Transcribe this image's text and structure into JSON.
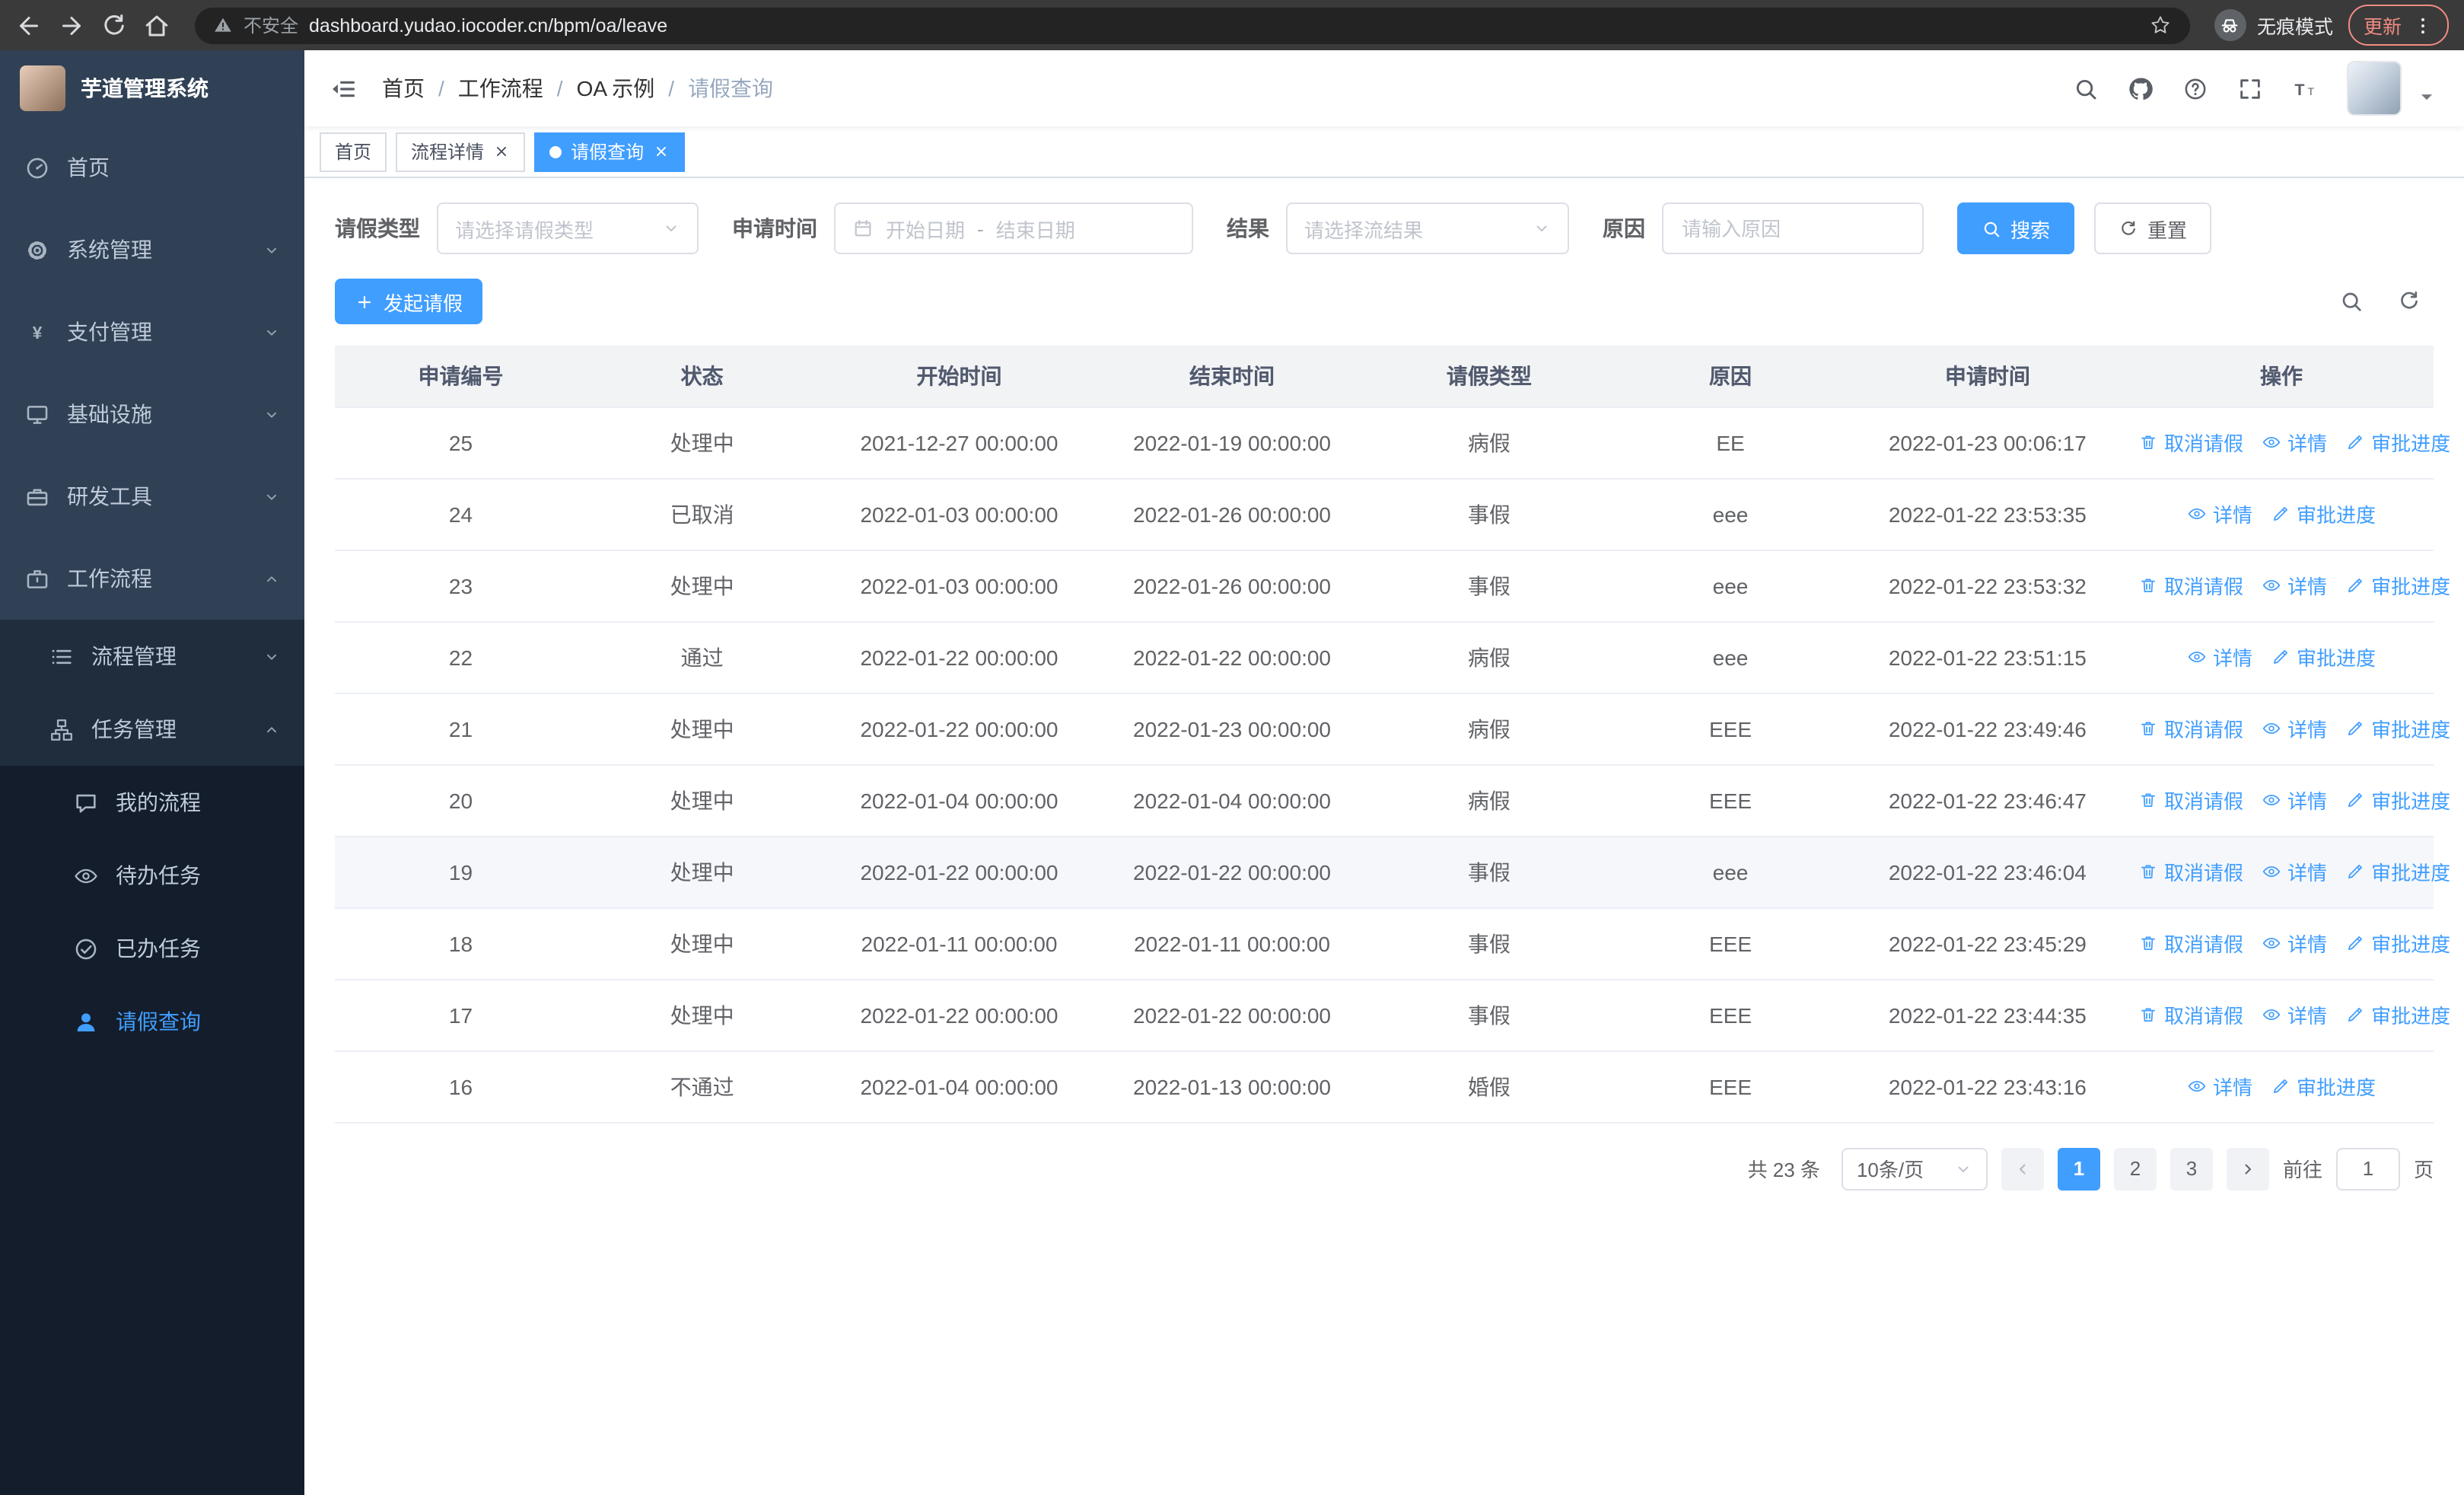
{
  "browser": {
    "security_label": "不安全",
    "url": "dashboard.yudao.iocoder.cn/bpm/oa/leave",
    "incognito_label": "无痕模式",
    "update_label": "更新"
  },
  "sidebar": {
    "logo_title": "芋道管理系统",
    "items": [
      {
        "name": "home",
        "label": "首页",
        "icon": "dashboard",
        "level": 1
      },
      {
        "name": "system-management",
        "label": "系统管理",
        "icon": "gear",
        "level": 1,
        "chevron": "down"
      },
      {
        "name": "payment-management",
        "label": "支付管理",
        "icon": "yen",
        "level": 1,
        "chevron": "down"
      },
      {
        "name": "infrastructure",
        "label": "基础设施",
        "icon": "monitor",
        "level": 1,
        "chevron": "down"
      },
      {
        "name": "dev-tools",
        "label": "研发工具",
        "icon": "toolbox",
        "level": 1,
        "chevron": "down"
      },
      {
        "name": "workflow",
        "label": "工作流程",
        "icon": "briefcase",
        "level": 1,
        "chevron": "up"
      },
      {
        "name": "process-management",
        "label": "流程管理",
        "icon": "list",
        "level": 2,
        "chevron": "down"
      },
      {
        "name": "task-management",
        "label": "任务管理",
        "icon": "flow",
        "level": 2,
        "chevron": "up"
      },
      {
        "name": "my-process",
        "label": "我的流程",
        "icon": "chat",
        "level": 3
      },
      {
        "name": "todo-tasks",
        "label": "待办任务",
        "icon": "eye",
        "level": 3
      },
      {
        "name": "done-tasks",
        "label": "已办任务",
        "icon": "check",
        "level": 3
      },
      {
        "name": "leave-query",
        "label": "请假查询",
        "icon": "user",
        "level": 3,
        "active": true
      }
    ]
  },
  "header": {
    "breadcrumb": [
      "首页",
      "工作流程",
      "OA 示例",
      "请假查询"
    ]
  },
  "tags": [
    {
      "label": "首页"
    },
    {
      "label": "流程详情",
      "closable": true
    },
    {
      "label": "请假查询",
      "closable": true,
      "active": true
    }
  ],
  "filters": {
    "leave_type_label": "请假类型",
    "leave_type_placeholder": "请选择请假类型",
    "apply_time_label": "申请时间",
    "start_date_placeholder": "开始日期",
    "range_separator": "-",
    "end_date_placeholder": "结束日期",
    "result_label": "结果",
    "result_placeholder": "请选择流结果",
    "reason_label": "原因",
    "reason_placeholder": "请输入原因",
    "search_button": "搜索",
    "reset_button": "重置"
  },
  "toolbar": {
    "create_button": "发起请假"
  },
  "table": {
    "headers": [
      "申请编号",
      "状态",
      "开始时间",
      "结束时间",
      "请假类型",
      "原因",
      "申请时间",
      "操作"
    ],
    "action_labels": {
      "cancel": "取消请假",
      "detail": "详情",
      "progress": "审批进度"
    },
    "rows": [
      {
        "id": "25",
        "status": "处理中",
        "start": "2021-12-27 00:00:00",
        "end": "2022-01-19 00:00:00",
        "type": "病假",
        "reason": "EE",
        "applied": "2022-01-23 00:06:17",
        "actions": [
          "cancel",
          "detail",
          "progress"
        ]
      },
      {
        "id": "24",
        "status": "已取消",
        "start": "2022-01-03 00:00:00",
        "end": "2022-01-26 00:00:00",
        "type": "事假",
        "reason": "eee",
        "applied": "2022-01-22 23:53:35",
        "actions": [
          "detail",
          "progress"
        ]
      },
      {
        "id": "23",
        "status": "处理中",
        "start": "2022-01-03 00:00:00",
        "end": "2022-01-26 00:00:00",
        "type": "事假",
        "reason": "eee",
        "applied": "2022-01-22 23:53:32",
        "actions": [
          "cancel",
          "detail",
          "progress"
        ]
      },
      {
        "id": "22",
        "status": "通过",
        "start": "2022-01-22 00:00:00",
        "end": "2022-01-22 00:00:00",
        "type": "病假",
        "reason": "eee",
        "applied": "2022-01-22 23:51:15",
        "actions": [
          "detail",
          "progress"
        ]
      },
      {
        "id": "21",
        "status": "处理中",
        "start": "2022-01-22 00:00:00",
        "end": "2022-01-23 00:00:00",
        "type": "病假",
        "reason": "EEE",
        "applied": "2022-01-22 23:49:46",
        "actions": [
          "cancel",
          "detail",
          "progress"
        ]
      },
      {
        "id": "20",
        "status": "处理中",
        "start": "2022-01-04 00:00:00",
        "end": "2022-01-04 00:00:00",
        "type": "病假",
        "reason": "EEE",
        "applied": "2022-01-22 23:46:47",
        "actions": [
          "cancel",
          "detail",
          "progress"
        ]
      },
      {
        "id": "19",
        "status": "处理中",
        "start": "2022-01-22 00:00:00",
        "end": "2022-01-22 00:00:00",
        "type": "事假",
        "reason": "eee",
        "applied": "2022-01-22 23:46:04",
        "actions": [
          "cancel",
          "detail",
          "progress"
        ],
        "hover": true
      },
      {
        "id": "18",
        "status": "处理中",
        "start": "2022-01-11 00:00:00",
        "end": "2022-01-11 00:00:00",
        "type": "事假",
        "reason": "EEE",
        "applied": "2022-01-22 23:45:29",
        "actions": [
          "cancel",
          "detail",
          "progress"
        ]
      },
      {
        "id": "17",
        "status": "处理中",
        "start": "2022-01-22 00:00:00",
        "end": "2022-01-22 00:00:00",
        "type": "事假",
        "reason": "EEE",
        "applied": "2022-01-22 23:44:35",
        "actions": [
          "cancel",
          "detail",
          "progress"
        ]
      },
      {
        "id": "16",
        "status": "不通过",
        "start": "2022-01-04 00:00:00",
        "end": "2022-01-13 00:00:00",
        "type": "婚假",
        "reason": "EEE",
        "applied": "2022-01-22 23:43:16",
        "actions": [
          "detail",
          "progress"
        ]
      }
    ]
  },
  "pagination": {
    "total_text": "共 23 条",
    "page_size": "10条/页",
    "pages": [
      "1",
      "2",
      "3"
    ],
    "active_page": "1",
    "goto_label": "前往",
    "goto_value": "1",
    "page_unit": "页"
  },
  "colors": {
    "primary": "#409eff",
    "update_red": "#f28b82",
    "sidebar_bg": "#304156"
  }
}
